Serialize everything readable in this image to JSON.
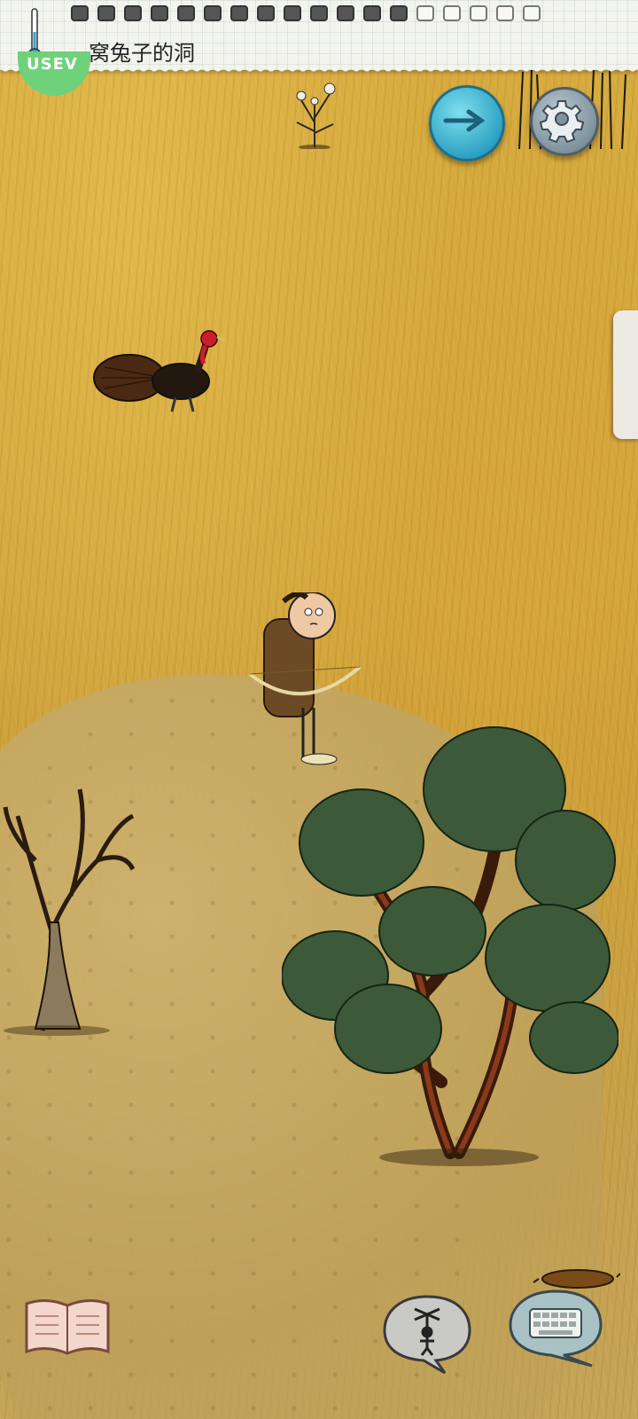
{
  "hud": {
    "location_label": "一窝兔子的洞",
    "badge_text": "USEV",
    "food_pips_total": 18,
    "food_pips_filled": 13
  },
  "buttons": {
    "compass": "compass-button",
    "settings": "settings-button",
    "book": "tech-book-button",
    "puppet": "emote-puppet-button",
    "keyboard": "chat-keyboard-button"
  },
  "colors": {
    "grass": "#d2a63c",
    "dirt": "#c6ac6c",
    "compass": "#2ea3c4",
    "settings": "#7f939f",
    "badge": "#6fd27a"
  }
}
